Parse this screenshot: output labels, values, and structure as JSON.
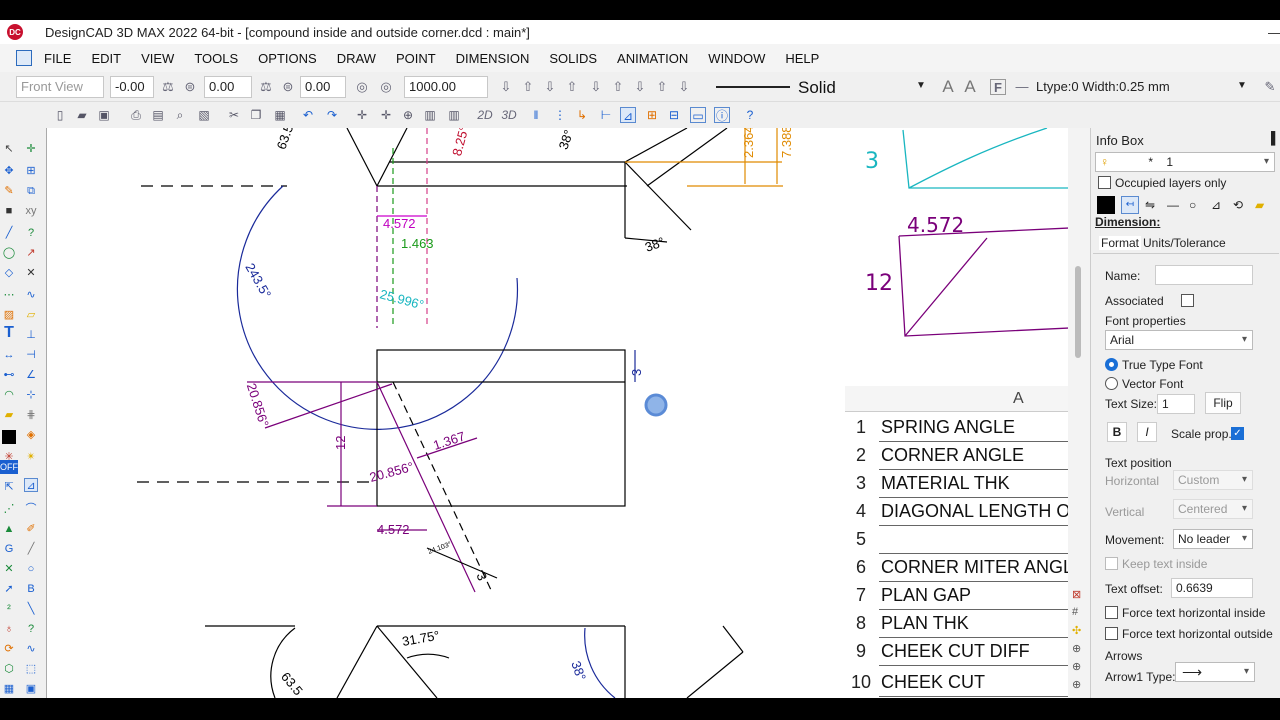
{
  "window": {
    "title": "DesignCAD 3D MAX 2022 64-bit - [compound inside and outside corner.dcd : main*]",
    "logo_text": "DC"
  },
  "menu": [
    "FILE",
    "EDIT",
    "VIEW",
    "TOOLS",
    "OPTIONS",
    "DRAW",
    "POINT",
    "DIMENSION",
    "SOLIDS",
    "ANIMATION",
    "WINDOW",
    "HELP"
  ],
  "toolbar": {
    "view_select": "Front View",
    "x": "-0.00",
    "y": "0.00",
    "z": "0.00",
    "scale": "1000.00",
    "linestyle": "Solid",
    "ltype": "Ltype:0  Width:0.25 mm",
    "mode_2d": "2D",
    "mode_3d": "3D"
  },
  "drawing": {
    "dims": {
      "a63_top": "63.5",
      "a8_25": "8.25°",
      "a38_top": "38°",
      "d2_364": "2.364",
      "d7_388": "7.388",
      "a38_right": "38°",
      "d4_572_top": "4.572",
      "d1_463": "1.463",
      "a243": "243.5°",
      "a25_996": "25.996°",
      "d3_a": "3",
      "a20_856_left": "20.856°",
      "d12": "12",
      "d1_367": "1.367",
      "a20_856_mid": "20.856°",
      "d4_572_bot": "4.572",
      "d24": "24.103°",
      "d3_b": "3",
      "a31_75": "31.75°",
      "a38_bot": "38°",
      "a63_bot": "63.5"
    },
    "sketch": {
      "s3": "3",
      "s4572": "4.572",
      "s12": "12"
    }
  },
  "spreadsheet": {
    "column": "A",
    "rows": [
      {
        "n": "1",
        "text": "SPRING ANGLE"
      },
      {
        "n": "2",
        "text": "CORNER ANGLE"
      },
      {
        "n": "3",
        "text": "MATERIAL THK"
      },
      {
        "n": "4",
        "text": "DIAGONAL LENGTH OF"
      },
      {
        "n": "5",
        "text": ""
      },
      {
        "n": "6",
        "text": "CORNER MITER ANGLE"
      },
      {
        "n": "7",
        "text": "PLAN GAP"
      },
      {
        "n": "8",
        "text": "PLAN THK"
      },
      {
        "n": "9",
        "text": "CHEEK CUT DIFF"
      },
      {
        "n": "10",
        "text": "CHEEK CUT"
      }
    ]
  },
  "infobox": {
    "title": "Info Box",
    "layer": "1",
    "layer_star": "*",
    "occupied_label": "Occupied layers only",
    "section": "Dimension:",
    "tab_format": "Format",
    "tab_units": "Units/Tolerance",
    "name_label": "Name:",
    "name_value": "",
    "associated_label": "Associated",
    "font_props_label": "Font properties",
    "font_value": "Arial",
    "truetype_label": "True Type Font",
    "vector_label": "Vector Font",
    "textsize_label": "Text Size:",
    "textsize_value": "1",
    "flip_label": "Flip",
    "bold_label": "B",
    "italic_label": "I",
    "scaleprop_label": "Scale prop.",
    "textpos_label": "Text position",
    "horizontal_label": "Horizontal",
    "horizontal_value": "Custom",
    "vertical_label": "Vertical",
    "vertical_value": "Centered",
    "movement_label": "Movement:",
    "movement_value": "No leader",
    "keep_inside_label": "Keep text inside",
    "offset_label": "Text offset:",
    "offset_value": "0.6639",
    "force_inside_label": "Force text horizontal inside",
    "force_outside_label": "Force text horizontal outside",
    "arrows_label": "Arrows",
    "arrow1_label": "Arrow1 Type:"
  }
}
